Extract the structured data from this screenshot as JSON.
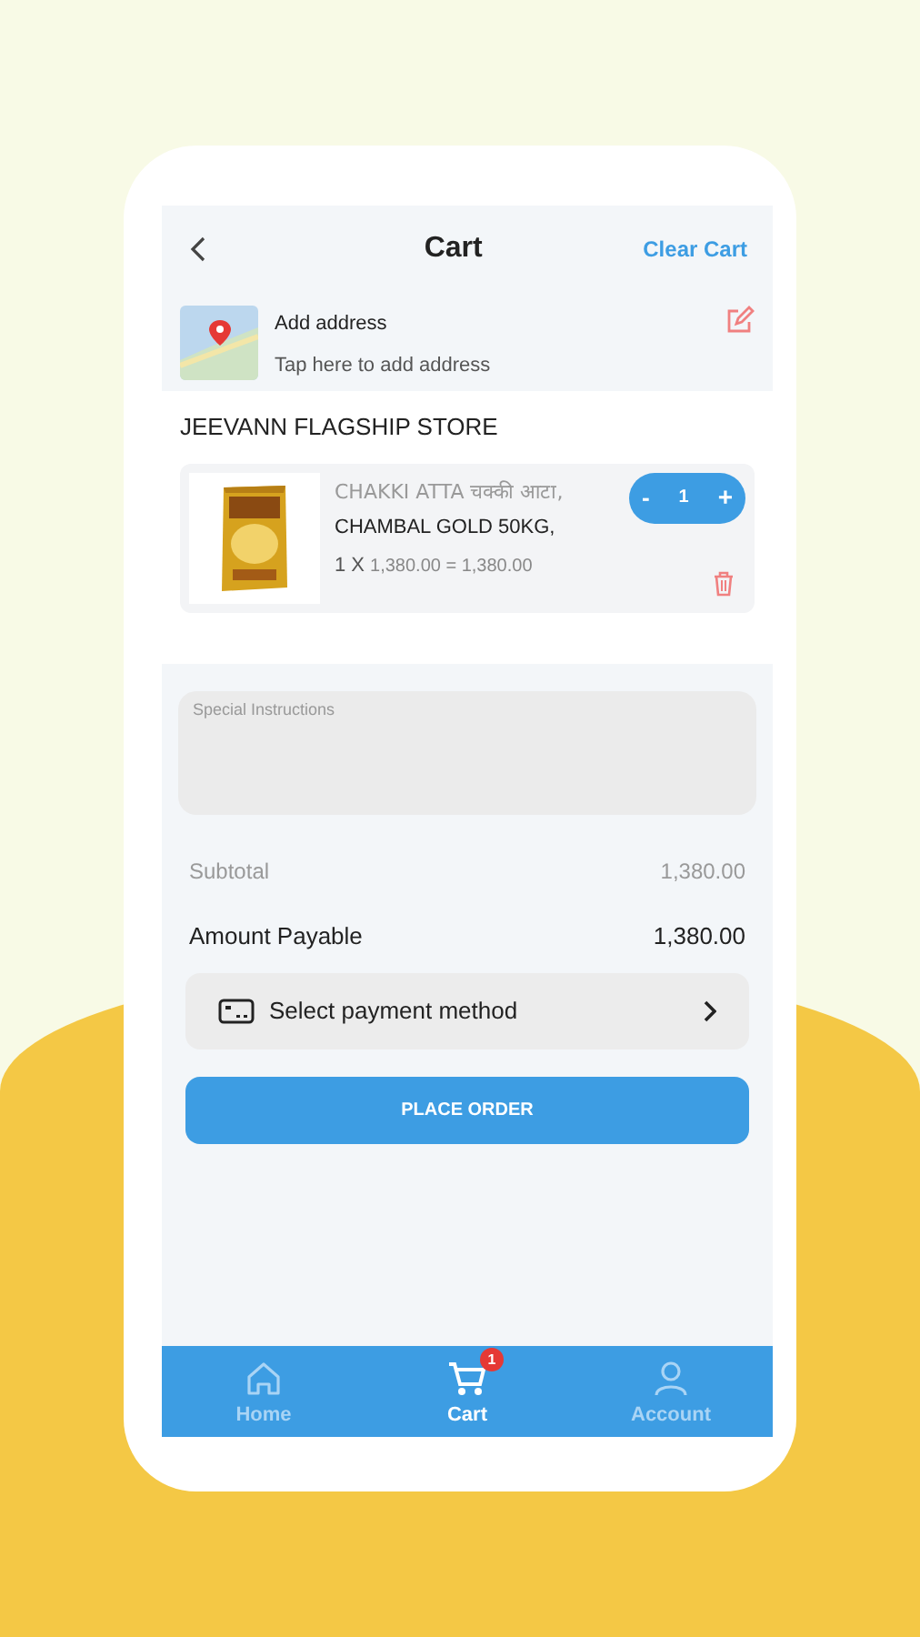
{
  "header": {
    "title": "Cart",
    "action": "Clear Cart"
  },
  "address": {
    "title": "Add address",
    "subtitle": "Tap here to add address"
  },
  "store": {
    "name": "JEEVANN FLAGSHIP STORE"
  },
  "items": [
    {
      "name": "CHAKKI ATTA चक्की आटा,",
      "variant": "CHAMBAL GOLD 50KG,",
      "multiplier": "1 X",
      "price": "1,380.00 = 1,380.00",
      "quantity": "1",
      "minus": "-",
      "plus": "+"
    }
  ],
  "special_instructions": {
    "placeholder": "Special Instructions"
  },
  "totals": [
    {
      "label": "Subtotal",
      "value": "1,380.00",
      "emphasis": false
    },
    {
      "label": "Amount Payable",
      "value": "1,380.00",
      "emphasis": true
    }
  ],
  "payment": {
    "label": "Select payment method"
  },
  "place_order": "PLACE ORDER",
  "nav": [
    {
      "label": "Home",
      "selected": false
    },
    {
      "label": "Cart",
      "selected": true,
      "badge": "1"
    },
    {
      "label": "Account",
      "selected": false
    }
  ]
}
